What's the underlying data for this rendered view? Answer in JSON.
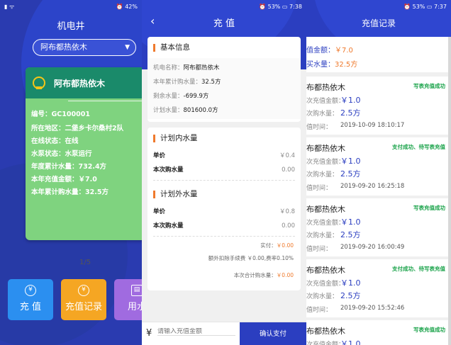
{
  "screen1": {
    "status_left": "▮ ᯤ",
    "status_right": "⏰ 42%",
    "title": "机电井",
    "dropdown_value": "阿布都热依木",
    "card": {
      "name": "阿布都热依木",
      "rows": [
        "编号：GC100001",
        "所在地区：二堡乡卡尔桑村2队",
        "在线状态：在线",
        "水泵状态：水泵运行",
        "年度累计水量：732.4方",
        "本年充值金额：￥7.0",
        "本年累计购水量：32.5方"
      ]
    },
    "pager": "1/5",
    "buttons": [
      {
        "label": "充 值",
        "icon": "¥",
        "color": "#2b8ff0"
      },
      {
        "label": "充值记录",
        "icon": "¥",
        "color": "#f5a623"
      },
      {
        "label": "用水",
        "icon": "▤",
        "color": "#a06be0"
      }
    ]
  },
  "screen2": {
    "status_right": "⏰ 53% ▭ 7:38",
    "title": "充 值",
    "basic": {
      "header": "基本信息",
      "rows": [
        {
          "label": "机电名称：",
          "value": "阿布都热依木"
        },
        {
          "label": "本年累计购水量：",
          "value": "32.5方"
        },
        {
          "label": "剩余水量：",
          "value": "-699.9方"
        },
        {
          "label": "计划水量：",
          "value": "801600.0方"
        }
      ]
    },
    "in_plan": {
      "header": "计划内水量",
      "price_label": "单价",
      "price_value": "￥0.4",
      "qty_label": "本次购水量",
      "qty_value": "0.00"
    },
    "out_plan": {
      "header": "计划外水量",
      "price_label": "单价",
      "price_value": "￥0.8",
      "qty_label": "本次购水量",
      "qty_value": "0.00"
    },
    "paid_label": "实付：",
    "paid_value": "￥0.00",
    "fee_note": "额外扣除手续费 ￥0.00,费率0.10%",
    "total_label": "本次合计购水量：",
    "total_value": "￥0.00",
    "yen": "¥",
    "amount_placeholder": "请输入充值金额",
    "pay_button": "确认支付"
  },
  "screen3": {
    "status_right": "⏰ 53% ▭ 7:37",
    "title": "充值记录",
    "total_amount_label": "值金额：",
    "total_amount_value": "￥7.0",
    "total_buy_label": "买水量：",
    "total_buy_value": "32.5方",
    "records": [
      {
        "name": "布都热依木",
        "status": "写表充值成功",
        "amount_label": "次充值金额：",
        "amount": "￥1.0",
        "water_label": "次购水量：",
        "water": "2.5方",
        "time_label": "值时间：",
        "time": "2019-10-09 18:10:17"
      },
      {
        "name": "布都热依木",
        "status": "支付成功、待写表充值",
        "amount_label": "次充值金额：",
        "amount": "￥1.0",
        "water_label": "次购水量：",
        "water": "2.5方",
        "time_label": "值时间：",
        "time": "2019-09-20 16:25:18"
      },
      {
        "name": "布都热依木",
        "status": "写表充值成功",
        "amount_label": "次充值金额：",
        "amount": "￥1.0",
        "water_label": "次购水量：",
        "water": "2.5方",
        "time_label": "值时间：",
        "time": "2019-09-20 16:00:49"
      },
      {
        "name": "布都热依木",
        "status": "支付成功、待写表充值",
        "amount_label": "次充值金额：",
        "amount": "￥1.0",
        "water_label": "次购水量：",
        "water": "2.5方",
        "time_label": "值时间：",
        "time": "2019-09-20 15:52:46"
      },
      {
        "name": "布都热依木",
        "status": "写表充值成功",
        "amount_label": "次充值金额：",
        "amount": "￥1.0",
        "water_label": "",
        "water": "",
        "time_label": "",
        "time": ""
      }
    ]
  }
}
